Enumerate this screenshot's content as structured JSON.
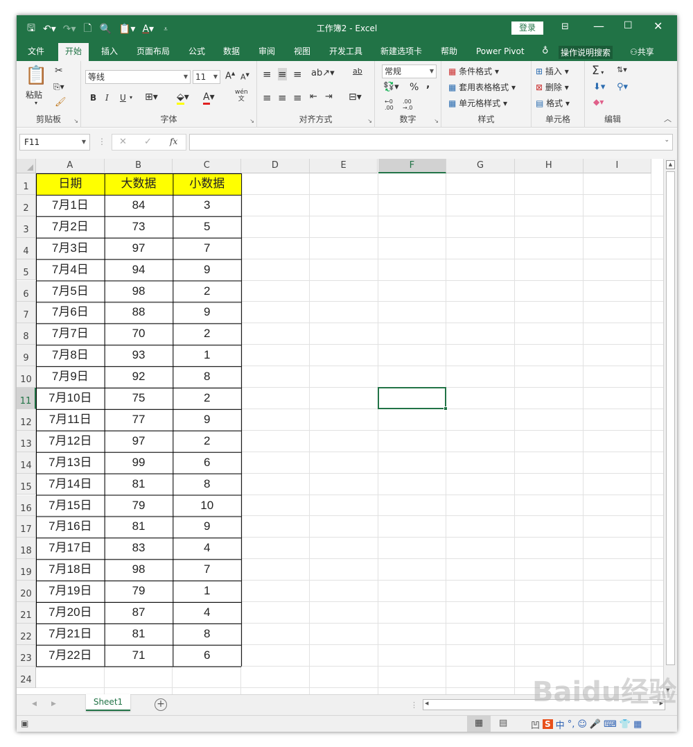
{
  "window": {
    "title": "工作簿2  -  Excel",
    "login_label": "登录",
    "quick_access": [
      "save-icon",
      "undo-icon",
      "redo-icon",
      "new-icon",
      "print-preview-icon",
      "paste-icon",
      "font-color-icon",
      "customize-icon"
    ]
  },
  "tabs": [
    {
      "label": "文件",
      "active": false
    },
    {
      "label": "开始",
      "active": true
    },
    {
      "label": "插入",
      "active": false
    },
    {
      "label": "页面布局",
      "active": false
    },
    {
      "label": "公式",
      "active": false
    },
    {
      "label": "数据",
      "active": false
    },
    {
      "label": "审阅",
      "active": false
    },
    {
      "label": "视图",
      "active": false
    },
    {
      "label": "开发工具",
      "active": false
    },
    {
      "label": "新建选项卡",
      "active": false
    },
    {
      "label": "帮助",
      "active": false
    },
    {
      "label": "Power Pivot",
      "active": false
    }
  ],
  "tell_me": "操作说明搜索",
  "share_label": "共享",
  "ribbon": {
    "clipboard": {
      "label": "剪贴板",
      "paste_label": "粘贴"
    },
    "font": {
      "label": "字体",
      "font_name": "等线",
      "font_size": "11",
      "bold": "B",
      "italic": "I",
      "underline": "U",
      "wen": "wén",
      "wen2": "文"
    },
    "alignment": {
      "label": "对齐方式",
      "wrap": "ab"
    },
    "number": {
      "label": "数字",
      "format": "常规",
      "percent": "%",
      "comma": ","
    },
    "styles": {
      "label": "样式",
      "conditional": "条件格式",
      "table": "套用表格格式",
      "cell_styles": "单元格样式"
    },
    "cells": {
      "label": "单元格",
      "insert": "插入",
      "delete": "删除",
      "format": "格式"
    },
    "editing": {
      "label": "编辑",
      "sum": "Σ"
    }
  },
  "formula_bar": {
    "name_box": "F11",
    "fx": "fx",
    "value": ""
  },
  "columns": [
    "A",
    "B",
    "C",
    "D",
    "E",
    "F",
    "G",
    "H",
    "I"
  ],
  "selected_column": "F",
  "selected_row": 11,
  "active_cell": "F11",
  "rows": [
    "1",
    "2",
    "3",
    "4",
    "5",
    "6",
    "7",
    "8",
    "9",
    "10",
    "11",
    "12",
    "13",
    "14",
    "15",
    "16",
    "17",
    "18",
    "19",
    "20",
    "21",
    "22",
    "23",
    "24"
  ],
  "table": {
    "headers": [
      "日期",
      "大数据",
      "小数据"
    ],
    "header_fill": "#ffff00",
    "data": [
      [
        "7月1日",
        "84",
        "3"
      ],
      [
        "7月2日",
        "73",
        "5"
      ],
      [
        "7月3日",
        "97",
        "7"
      ],
      [
        "7月4日",
        "94",
        "9"
      ],
      [
        "7月5日",
        "98",
        "2"
      ],
      [
        "7月6日",
        "88",
        "9"
      ],
      [
        "7月7日",
        "70",
        "2"
      ],
      [
        "7月8日",
        "93",
        "1"
      ],
      [
        "7月9日",
        "92",
        "8"
      ],
      [
        "7月10日",
        "75",
        "2"
      ],
      [
        "7月11日",
        "77",
        "9"
      ],
      [
        "7月12日",
        "97",
        "2"
      ],
      [
        "7月13日",
        "99",
        "6"
      ],
      [
        "7月14日",
        "81",
        "8"
      ],
      [
        "7月15日",
        "79",
        "10"
      ],
      [
        "7月16日",
        "81",
        "9"
      ],
      [
        "7月17日",
        "83",
        "4"
      ],
      [
        "7月18日",
        "98",
        "7"
      ],
      [
        "7月19日",
        "79",
        "1"
      ],
      [
        "7月20日",
        "87",
        "4"
      ],
      [
        "7月21日",
        "81",
        "8"
      ],
      [
        "7月22日",
        "71",
        "6"
      ]
    ]
  },
  "sheet_tabs": [
    "Sheet1"
  ],
  "watermark": "Baidu经验",
  "colors": {
    "accent": "#217346",
    "header_yellow": "#ffff00"
  }
}
